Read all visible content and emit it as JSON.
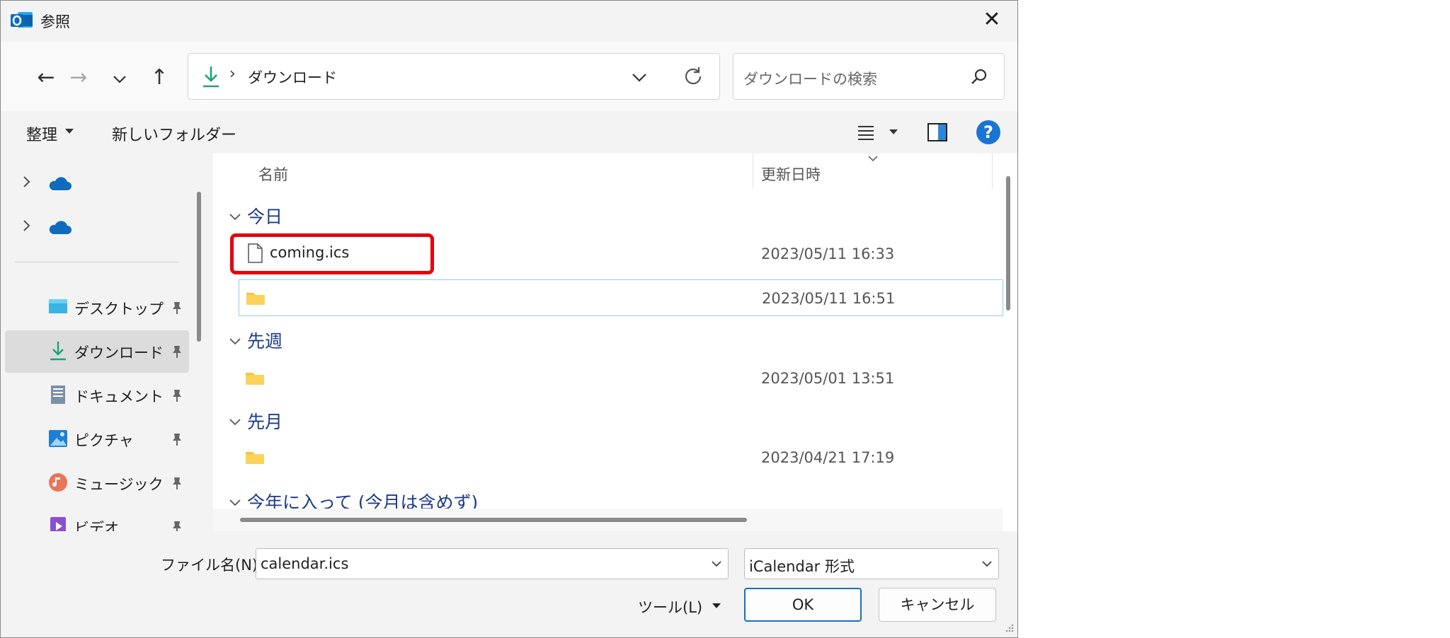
{
  "window": {
    "title": "参照",
    "close_glyph": "✕"
  },
  "nav": {
    "back_glyph": "←",
    "forward_glyph": "→",
    "recent_glyph": "⌵",
    "up_glyph": "↑",
    "address_sep": "›",
    "address": "ダウンロード",
    "search_placeholder": "ダウンロードの検索"
  },
  "commands": {
    "organize": "整理",
    "new_folder": "新しいフォルダー",
    "help_glyph": "?"
  },
  "sidebar": {
    "items": [
      {
        "label": "デスクトップ",
        "icon": "desktop-icon"
      },
      {
        "label": "ダウンロード",
        "icon": "download-icon"
      },
      {
        "label": "ドキュメント",
        "icon": "document-icon"
      },
      {
        "label": "ピクチャ",
        "icon": "picture-icon"
      },
      {
        "label": "ミュージック",
        "icon": "music-icon"
      },
      {
        "label": "ビデオ",
        "icon": "video-icon"
      }
    ]
  },
  "columns": {
    "name": "名前",
    "date": "更新日時"
  },
  "groups": [
    {
      "label": "今日",
      "rows": [
        {
          "name": "coming.ics",
          "date": "2023/05/11 16:33",
          "type": "file"
        },
        {
          "name": "",
          "date": "2023/05/11 16:51",
          "type": "folder"
        }
      ]
    },
    {
      "label": "先週",
      "rows": [
        {
          "name": "",
          "date": "2023/05/01 13:51",
          "type": "folder"
        }
      ]
    },
    {
      "label": "先月",
      "rows": [
        {
          "name": "",
          "date": "2023/04/21 17:19",
          "type": "folder"
        }
      ]
    },
    {
      "label": "今年に入って (今月は含めず)",
      "rows": []
    }
  ],
  "bottom": {
    "filename_label": "ファイル名(N):",
    "filename_value": "calendar.ics",
    "filetype_value": "iCalendar 形式",
    "tools_label": "ツール(L)",
    "ok_label": "OK",
    "cancel_label": "キャンセル"
  },
  "colors": {
    "accent": "#1a74d4",
    "highlight": "#e8000c",
    "group_text": "#1d3b8b",
    "folder": "#f8c33a"
  }
}
